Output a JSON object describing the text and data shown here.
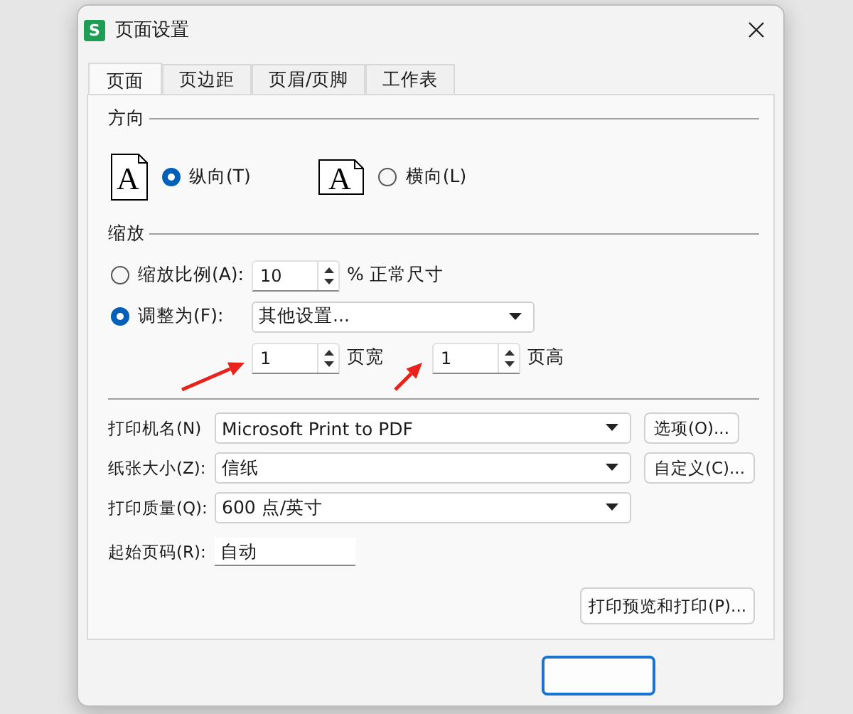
{
  "window": {
    "title": "页面设置",
    "app_icon": "S"
  },
  "tabs": [
    {
      "label": "页面",
      "selected": true
    },
    {
      "label": "页边距",
      "selected": false
    },
    {
      "label": "页眉/页脚",
      "selected": false
    },
    {
      "label": "工作表",
      "selected": false
    }
  ],
  "orientation": {
    "heading": "方向",
    "options": [
      {
        "kind": "portrait",
        "glyph": "A",
        "label": "纵向(T)",
        "selected": true
      },
      {
        "kind": "landscape",
        "glyph": "A",
        "label": "横向(L)",
        "selected": false
      }
    ]
  },
  "scaling": {
    "heading": "缩放",
    "options": [
      {
        "label": "缩放比例(A):",
        "selected": false
      },
      {
        "label": "调整为(F):",
        "selected": true
      }
    ],
    "percent": {
      "value": "10",
      "suffix": "% 正常尺寸"
    },
    "fit_mode": "其他设置...",
    "pages_wide": {
      "value": "1",
      "label": "页宽"
    },
    "pages_tall": {
      "value": "1",
      "label": "页高"
    }
  },
  "printer_fields": [
    {
      "kind": "combo",
      "label": "打印机名(N)",
      "value": "Microsoft Print to PDF",
      "button": "选项(O)..."
    },
    {
      "kind": "combo",
      "label": "纸张大小(Z):",
      "value": "信纸",
      "button": "自定义(C)..."
    },
    {
      "kind": "combo",
      "label": "打印质量(Q):",
      "value": "600 点/英寸"
    },
    {
      "kind": "text",
      "label": "起始页码(R):",
      "value": "自动"
    }
  ],
  "preview_button": "打印预览和打印(P)...",
  "annotations": [
    {
      "kind": "arrow"
    },
    {
      "kind": "arrow"
    }
  ]
}
